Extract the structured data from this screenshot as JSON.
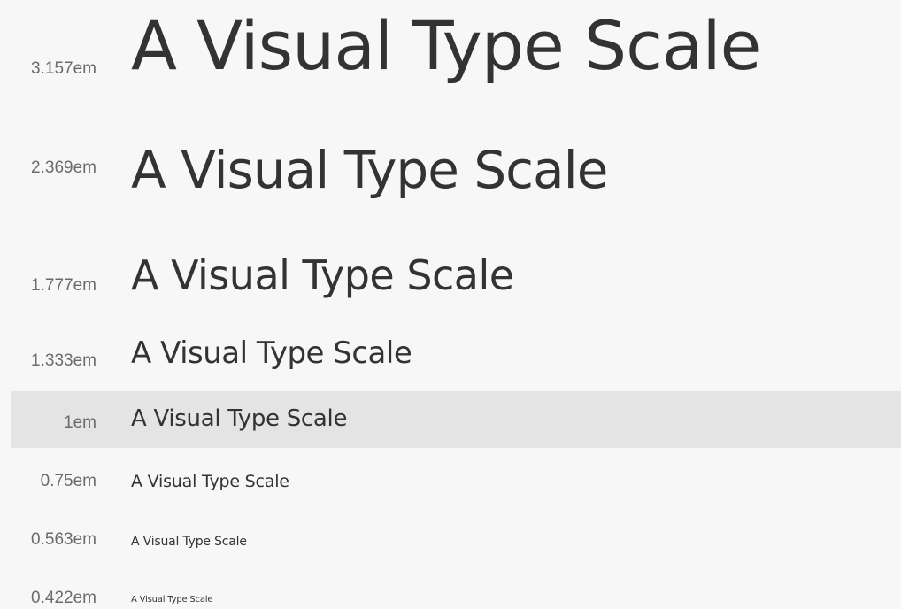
{
  "scale": [
    {
      "size_label": "3.157em",
      "sample_text": "A Visual Type Scale"
    },
    {
      "size_label": "2.369em",
      "sample_text": "A Visual Type Scale"
    },
    {
      "size_label": "1.777em",
      "sample_text": "A Visual Type Scale"
    },
    {
      "size_label": "1.333em",
      "sample_text": "A Visual Type Scale"
    },
    {
      "size_label": "1em",
      "sample_text": "A Visual Type Scale",
      "highlighted": true
    },
    {
      "size_label": "0.75em",
      "sample_text": "A Visual Type Scale"
    },
    {
      "size_label": "0.563em",
      "sample_text": "A Visual Type Scale"
    },
    {
      "size_label": "0.422em",
      "sample_text": "A Visual Type Scale"
    }
  ],
  "colors": {
    "background": "#f7f7f7",
    "highlight": "#e4e4e4",
    "label": "#6b6b6b",
    "sample": "#333333"
  }
}
